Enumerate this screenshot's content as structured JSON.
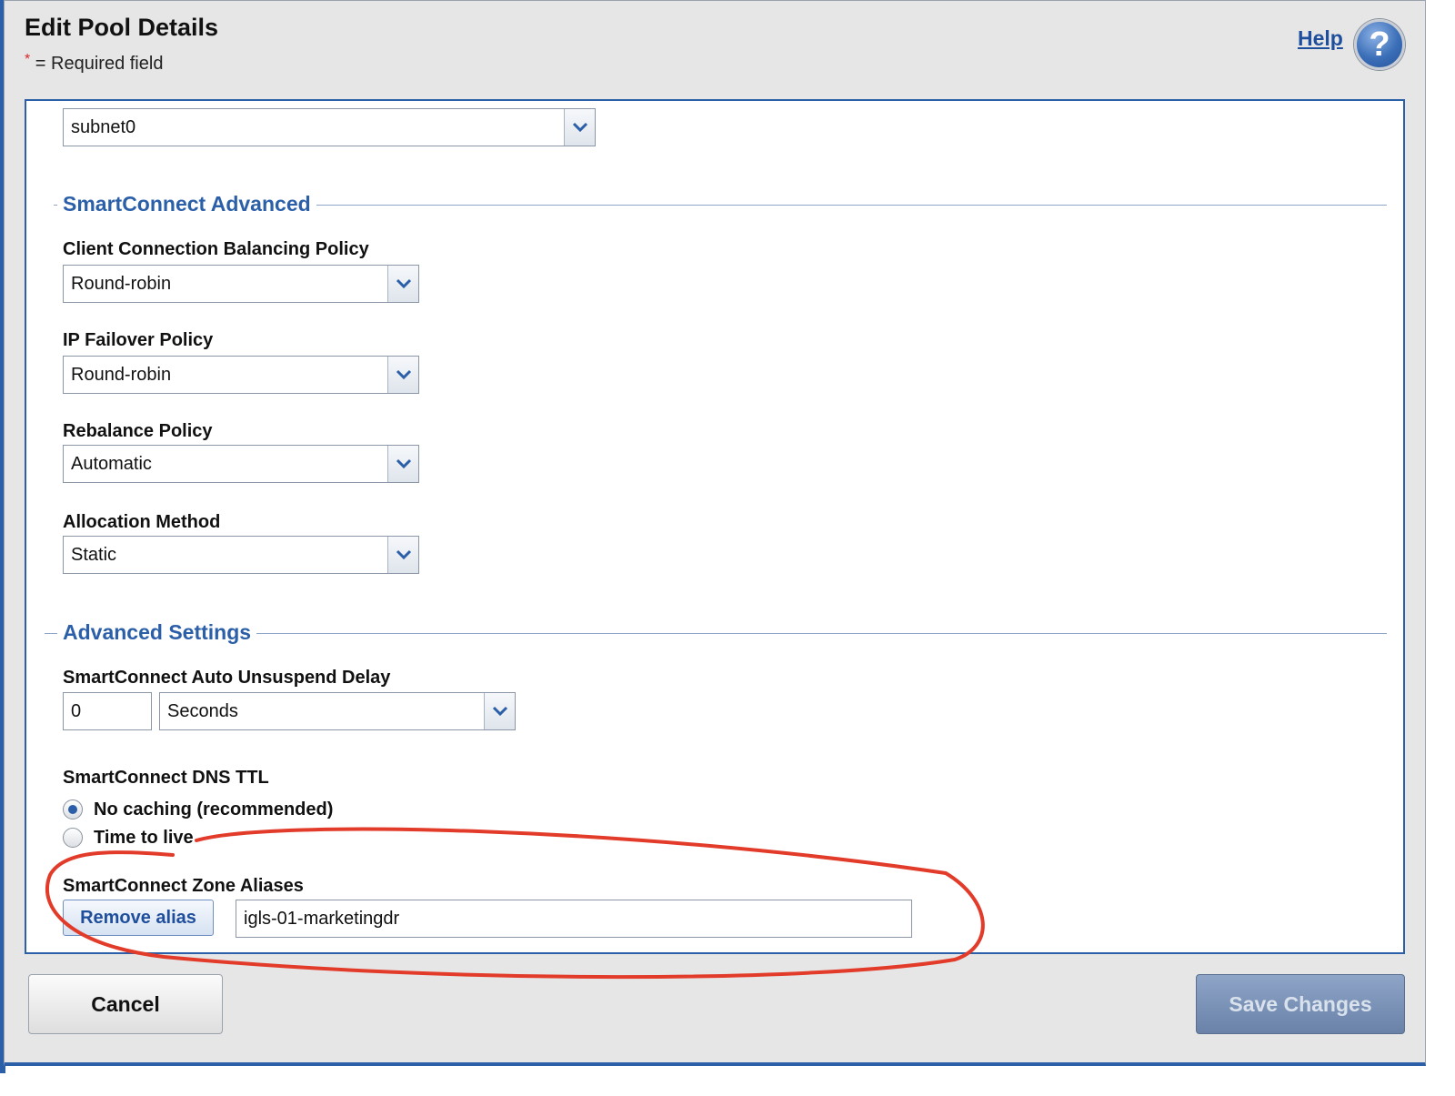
{
  "dialog": {
    "title": "Edit Pool Details",
    "required_star": "*",
    "required_text": "= Required field",
    "help_label": "Help",
    "help_icon_glyph": "?"
  },
  "subnet": {
    "value": "subnet0"
  },
  "smartconnect_advanced": {
    "legend": "SmartConnect Advanced",
    "client_balancing": {
      "label": "Client Connection Balancing Policy",
      "value": "Round-robin"
    },
    "ip_failover": {
      "label": "IP Failover Policy",
      "value": "Round-robin"
    },
    "rebalance": {
      "label": "Rebalance Policy",
      "value": "Automatic"
    },
    "allocation": {
      "label": "Allocation Method",
      "value": "Static"
    }
  },
  "advanced_settings": {
    "legend": "Advanced Settings",
    "unsuspend_delay": {
      "label": "SmartConnect Auto Unsuspend Delay",
      "value": "0",
      "unit": "Seconds"
    },
    "dns_ttl": {
      "label": "SmartConnect DNS TTL",
      "options": [
        {
          "label": "No caching (recommended)",
          "checked": true
        },
        {
          "label": "Time to live",
          "checked": false
        }
      ]
    },
    "zone_aliases": {
      "label": "SmartConnect Zone Aliases",
      "remove_label": "Remove alias",
      "value": "igls-01-marketingdr"
    }
  },
  "footer": {
    "cancel_label": "Cancel",
    "save_label": "Save Changes"
  },
  "colors": {
    "accent_blue": "#2b5fa8",
    "annotation_red": "#e23b2a",
    "dialog_bg": "#e6e6e6"
  },
  "icons": {
    "dropdown": "chevron-down-icon",
    "help": "help-icon",
    "annotation": "circled-annotation"
  }
}
